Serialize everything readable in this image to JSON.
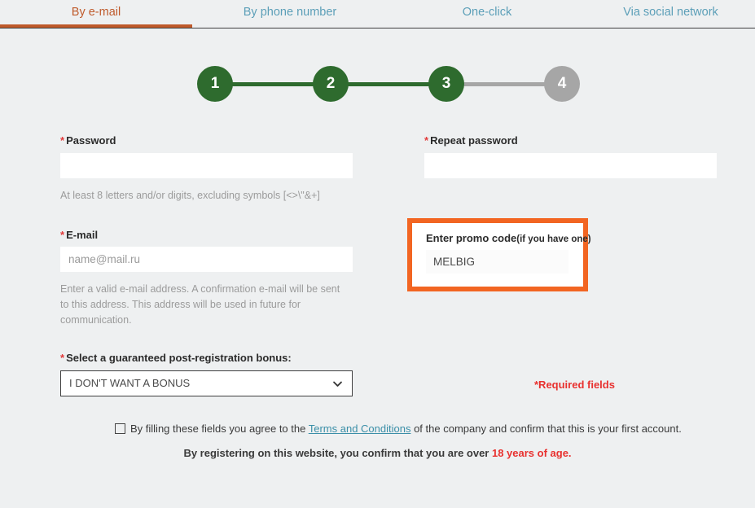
{
  "tabs": [
    {
      "label": "By e-mail",
      "active": true
    },
    {
      "label": "By phone number",
      "active": false
    },
    {
      "label": "One-click",
      "active": false
    },
    {
      "label": "Via social network",
      "active": false
    }
  ],
  "stepper": {
    "steps": [
      "1",
      "2",
      "3",
      "4"
    ],
    "current": 3,
    "done_color": "#2e6b2e",
    "todo_color": "#a6a6a6"
  },
  "form": {
    "password": {
      "label": "Password",
      "required_mark": "*",
      "value": "",
      "placeholder": "",
      "hint": "At least 8 letters and/or digits, excluding symbols [<>\\\"&+]"
    },
    "repeat_password": {
      "label": "Repeat password",
      "required_mark": "*",
      "value": "",
      "placeholder": ""
    },
    "email": {
      "label": "E-mail",
      "required_mark": "*",
      "value": "",
      "placeholder": "name@mail.ru",
      "hint": "Enter a valid e-mail address. A confirmation e-mail will be sent to this address. This address will be used in future for communication."
    },
    "promo": {
      "label": "Enter promo code",
      "label_sub": "(if you have one)",
      "value": "MELBIG",
      "placeholder": "",
      "border_color": "#f26522"
    },
    "bonus": {
      "label": "Select a guaranteed post-registration bonus:",
      "required_mark": "*",
      "selected": "I DON'T WANT A BONUS"
    },
    "required_note": "*Required fields"
  },
  "agreement": {
    "checked": false,
    "text_before": "By filling these fields you agree to the ",
    "link_text": "Terms and Conditions",
    "text_after": " of the company and confirm that this is your first account.",
    "age_text_before": "By registering on this website, you confirm that you are over ",
    "age_text_red": "18 years of age."
  }
}
